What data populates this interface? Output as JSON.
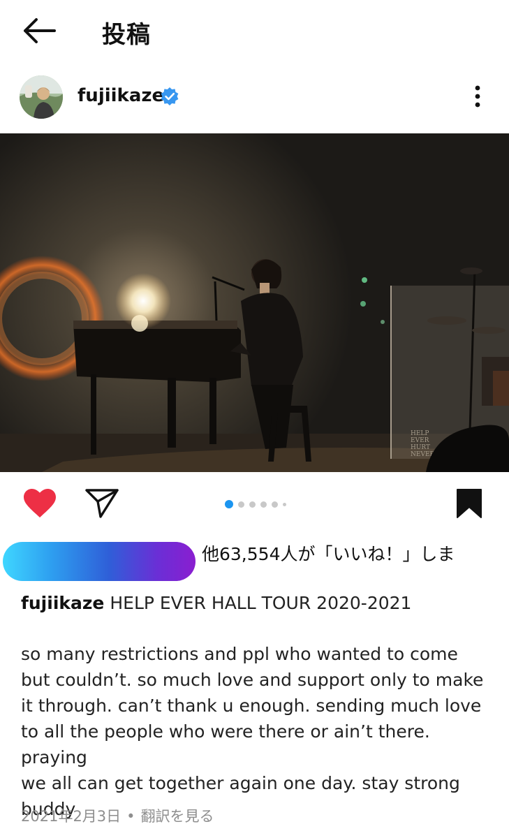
{
  "header": {
    "title": "投稿",
    "back_icon": "arrow-left-icon"
  },
  "post": {
    "username": "fujiikaze",
    "verified": true,
    "more_icon": "more-vertical-icon",
    "image_sign_text": "HELP EVER HURT NEVER"
  },
  "actions": {
    "like_icon": "heart-filled-icon",
    "like_color": "#ed2f45",
    "share_icon": "paper-plane-icon",
    "bookmark_icon": "bookmark-filled-icon",
    "carousel": {
      "count": 6,
      "active_index": 0,
      "active_color": "#1b95f0"
    }
  },
  "likes": {
    "text": "他63,554人が「いいね！」しま"
  },
  "caption": {
    "username": "fujiikaze",
    "headline": "HELP EVER HALL TOUR 2020-2021",
    "lines": [
      "so many restrictions and ppl who wanted to come",
      "but couldn’t. so much love and support only to make",
      "it through. can’t thank u enough. sending much love",
      "to all the people who were there or ain’t there. praying",
      "we all can get together again one day. stay strong",
      "buddy"
    ]
  },
  "meta": {
    "date": "2021年2月3日",
    "separator": "•",
    "translate_label": "翻訳を見る"
  }
}
